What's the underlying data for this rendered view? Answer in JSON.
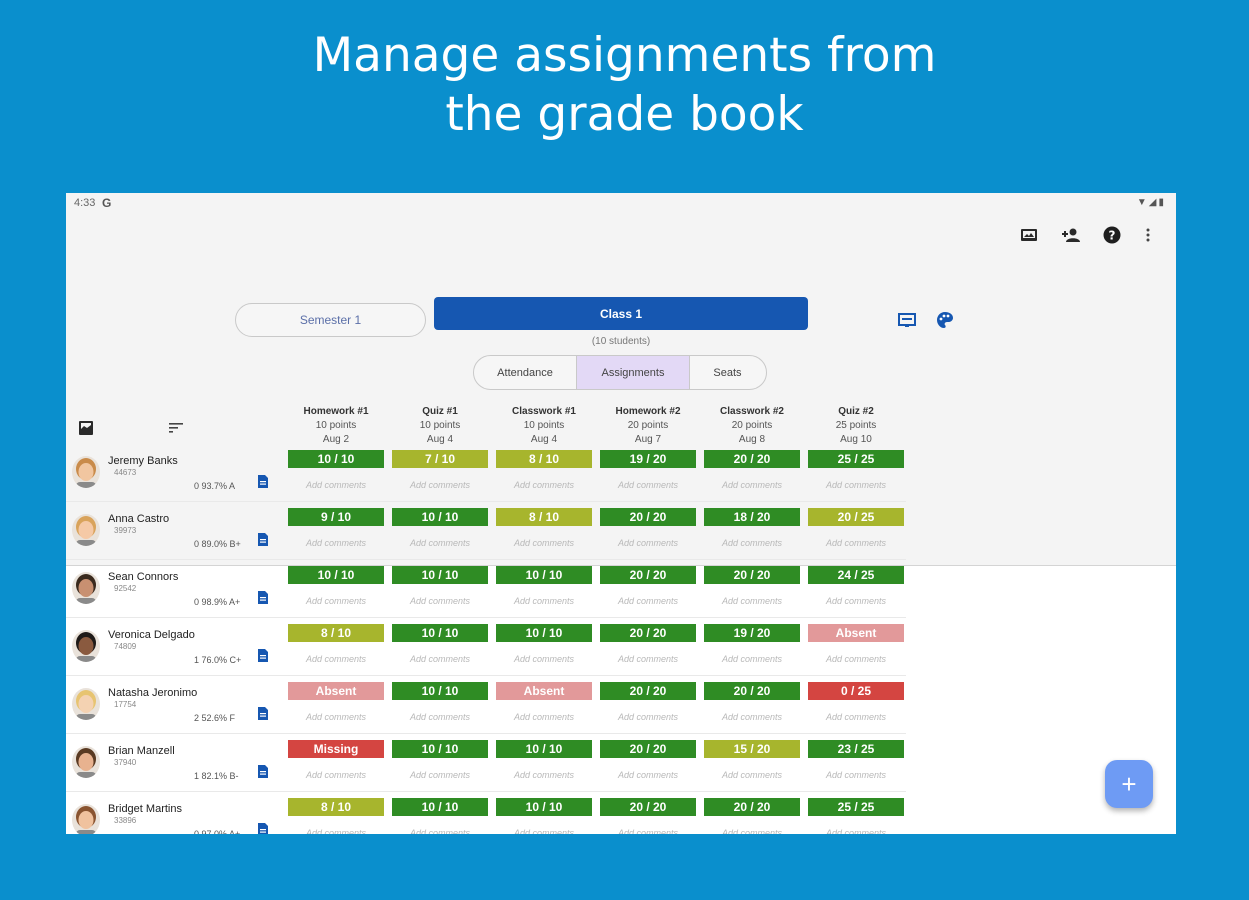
{
  "headline": {
    "line1": "Manage assignments from",
    "line2": "the grade book"
  },
  "status_bar": {
    "time": "4:33",
    "google_icon": "G"
  },
  "toolbar": {
    "icons": [
      "photo-album-icon",
      "person-add-icon",
      "help-icon",
      "more-vert-icon"
    ]
  },
  "nav": {
    "semester_label": "Semester 1",
    "class_label": "Class 1",
    "students_label": "(10 students)",
    "segments": [
      "Attendance",
      "Assignments",
      "Seats"
    ],
    "active_segment": "Assignments"
  },
  "columns": [
    {
      "title": "Homework #1",
      "points": "10 points",
      "date": "Aug 2"
    },
    {
      "title": "Quiz #1",
      "points": "10 points",
      "date": "Aug 4"
    },
    {
      "title": "Classwork #1",
      "points": "10 points",
      "date": "Aug 4"
    },
    {
      "title": "Homework #2",
      "points": "20 points",
      "date": "Aug 7"
    },
    {
      "title": "Classwork #2",
      "points": "20 points",
      "date": "Aug 8"
    },
    {
      "title": "Quiz #2",
      "points": "25 points",
      "date": "Aug 10"
    }
  ],
  "comment_placeholder": "Add comments",
  "status_colors": {
    "full": "#2f8c24",
    "partial": "#a7b52d",
    "absent": "#e2999a",
    "missing": "#d44541"
  },
  "students": [
    {
      "name": "Jeremy Banks",
      "id": "44673",
      "summary": "0  93.7%  A",
      "scores": [
        {
          "text": "10 / 10",
          "status": "full"
        },
        {
          "text": "7 / 10",
          "status": "partial"
        },
        {
          "text": "8 / 10",
          "status": "partial"
        },
        {
          "text": "19 / 20",
          "status": "full"
        },
        {
          "text": "20 / 20",
          "status": "full"
        },
        {
          "text": "25 / 25",
          "status": "full"
        }
      ]
    },
    {
      "name": "Anna Castro",
      "id": "39973",
      "summary": "0  89.0%  B+",
      "scores": [
        {
          "text": "9 / 10",
          "status": "full"
        },
        {
          "text": "10 / 10",
          "status": "full"
        },
        {
          "text": "8 / 10",
          "status": "partial"
        },
        {
          "text": "20 / 20",
          "status": "full"
        },
        {
          "text": "18 / 20",
          "status": "full"
        },
        {
          "text": "20 / 25",
          "status": "partial"
        }
      ]
    },
    {
      "name": "Sean Connors",
      "id": "92542",
      "summary": "0  98.9%  A+",
      "scores": [
        {
          "text": "10 / 10",
          "status": "full"
        },
        {
          "text": "10 / 10",
          "status": "full"
        },
        {
          "text": "10 / 10",
          "status": "full"
        },
        {
          "text": "20 / 20",
          "status": "full"
        },
        {
          "text": "20 / 20",
          "status": "full"
        },
        {
          "text": "24 / 25",
          "status": "full"
        }
      ]
    },
    {
      "name": "Veronica Delgado",
      "id": "74809",
      "summary": "1  76.0%  C+",
      "scores": [
        {
          "text": "8 / 10",
          "status": "partial"
        },
        {
          "text": "10 / 10",
          "status": "full"
        },
        {
          "text": "10 / 10",
          "status": "full"
        },
        {
          "text": "20 / 20",
          "status": "full"
        },
        {
          "text": "19 / 20",
          "status": "full"
        },
        {
          "text": "Absent",
          "status": "absent"
        }
      ]
    },
    {
      "name": "Natasha Jeronimo",
      "id": "17754",
      "summary": "2  52.6%  F",
      "scores": [
        {
          "text": "Absent",
          "status": "absent"
        },
        {
          "text": "10 / 10",
          "status": "full"
        },
        {
          "text": "Absent",
          "status": "absent"
        },
        {
          "text": "20 / 20",
          "status": "full"
        },
        {
          "text": "20 / 20",
          "status": "full"
        },
        {
          "text": "0 / 25",
          "status": "missing"
        }
      ]
    },
    {
      "name": "Brian Manzell",
      "id": "37940",
      "summary": "1  82.1%  B-",
      "scores": [
        {
          "text": "Missing",
          "status": "missing"
        },
        {
          "text": "10 / 10",
          "status": "full"
        },
        {
          "text": "10 / 10",
          "status": "full"
        },
        {
          "text": "20 / 20",
          "status": "full"
        },
        {
          "text": "15 / 20",
          "status": "partial"
        },
        {
          "text": "23 / 25",
          "status": "full"
        }
      ]
    },
    {
      "name": "Bridget Martins",
      "id": "33896",
      "summary": "0  97.0%  A+",
      "scores": [
        {
          "text": "8 / 10",
          "status": "partial"
        },
        {
          "text": "10 / 10",
          "status": "full"
        },
        {
          "text": "10 / 10",
          "status": "full"
        },
        {
          "text": "20 / 20",
          "status": "full"
        },
        {
          "text": "20 / 20",
          "status": "full"
        },
        {
          "text": "25 / 25",
          "status": "full"
        }
      ]
    }
  ],
  "avatar_colors": {
    "hair": [
      "#c98b4a",
      "#d9a35b",
      "#3a2a1e",
      "#1e1a18",
      "#e7c471",
      "#5a3a22",
      "#8a5430"
    ],
    "skin": [
      "#f1c6a0",
      "#f5c9a6",
      "#c89071",
      "#8a5a3f",
      "#f4d2b2",
      "#e8b28f",
      "#f0c29e"
    ]
  },
  "fab_label": "+"
}
